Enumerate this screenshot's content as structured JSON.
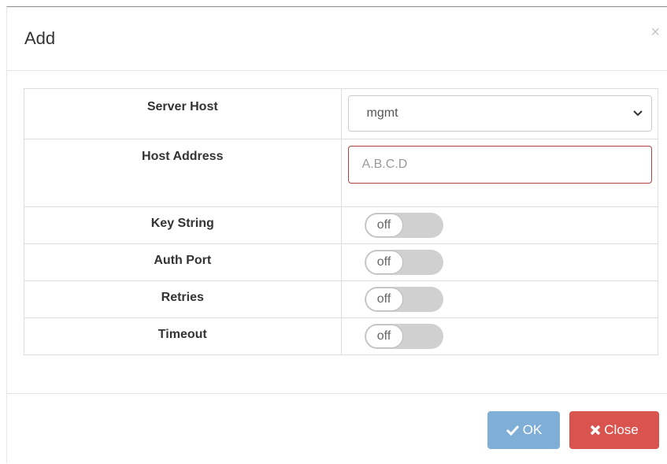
{
  "modal": {
    "title": "Add",
    "close_glyph": "×"
  },
  "form": {
    "rows": [
      {
        "label": "Server Host",
        "type": "select",
        "value": "mgmt"
      },
      {
        "label": "Host Address",
        "type": "input",
        "value": "",
        "placeholder": "A.B.C.D"
      },
      {
        "label": "Key String",
        "type": "toggle",
        "state": "off"
      },
      {
        "label": "Auth Port",
        "type": "toggle",
        "state": "off"
      },
      {
        "label": "Retries",
        "type": "toggle",
        "state": "off"
      },
      {
        "label": "Timeout",
        "type": "toggle",
        "state": "off"
      }
    ]
  },
  "footer": {
    "ok_label": "OK",
    "close_label": "Close"
  },
  "colors": {
    "ok_button": "#7fafd6",
    "close_button": "#d9534f",
    "invalid_border": "#a94442"
  },
  "icons": {
    "ok": "check-icon",
    "close": "x-mark-icon",
    "select": "chevron-down-icon"
  }
}
